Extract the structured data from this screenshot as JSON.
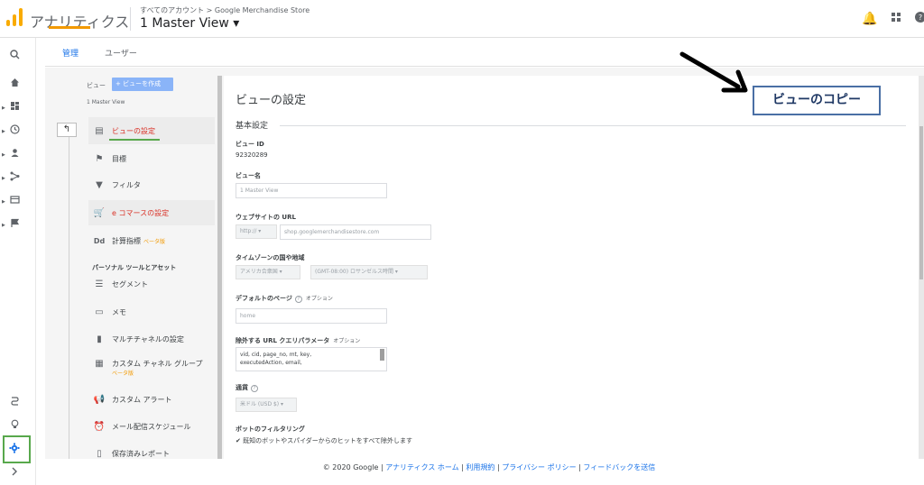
{
  "header": {
    "app_name": "アナリティクス",
    "breadcrumb": "すべてのアカウント > Google Merchandise Store",
    "view_selector": "1 Master View ▾"
  },
  "tabs": [
    {
      "label": "管理"
    },
    {
      "label": "ユーザー"
    }
  ],
  "left_column": {
    "view_label": "ビュー",
    "create_button": "+ ビューを作成",
    "view_name": "1 Master View",
    "menu": [
      {
        "label": "ビューの設定",
        "icon": "document-icon"
      },
      {
        "label": "目標",
        "icon": "flag-icon"
      },
      {
        "label": "フィルタ",
        "icon": "filter-icon"
      },
      {
        "label": "e コマースの設定",
        "icon": "cart-icon"
      },
      {
        "label": "計算指標",
        "icon": "dd-icon",
        "badge": "ベータ版"
      }
    ],
    "section_label": "パーソナル ツールとアセット",
    "tools": [
      {
        "label": "セグメント"
      },
      {
        "label": "メモ"
      },
      {
        "label": "マルチチャネルの設定"
      },
      {
        "label": "カスタム チャネル グループ",
        "badge": "ベータ版"
      },
      {
        "label": "カスタム アラート"
      },
      {
        "label": "メール配信スケジュール"
      },
      {
        "label": "保存済みレポート"
      }
    ]
  },
  "settings": {
    "title": "ビューの設定",
    "section": "基本設定",
    "view_id_label": "ビュー ID",
    "view_id": "92320289",
    "view_name_label": "ビュー名",
    "view_name_value": "1 Master View",
    "website_url_label": "ウェブサイトの URL",
    "protocol": "http:// ▾",
    "website_url": "shop.googlemerchandisestore.com",
    "timezone_label": "タイムゾーンの国や地域",
    "country": "アメリカ合衆国 ▾",
    "timezone": "(GMT-08:00) ロサンゼルス時間 ▾",
    "default_page_label": "デフォルトのページ",
    "optional": "オプション",
    "default_page": "home",
    "exclude_params_label": "除外する URL クエリパラメータ",
    "exclude_params_line1": "vid, cid, page_no, mt, key,",
    "exclude_params_line2": "executedAction, email,",
    "currency_label": "通貨",
    "currency": "米ドル (USD $) ▾",
    "bot_label": "ボットのフィルタリング",
    "bot_checkbox": "✔ 既知のボットやスパイダーからのヒットをすべて除外します"
  },
  "annotation": {
    "label": "ビューのコピー"
  },
  "footer": {
    "copyright": "© 2020 Google",
    "links": [
      "アナリティクス ホーム",
      "利用規約",
      "プライバシー ポリシー",
      "フィードバックを送信"
    ]
  }
}
